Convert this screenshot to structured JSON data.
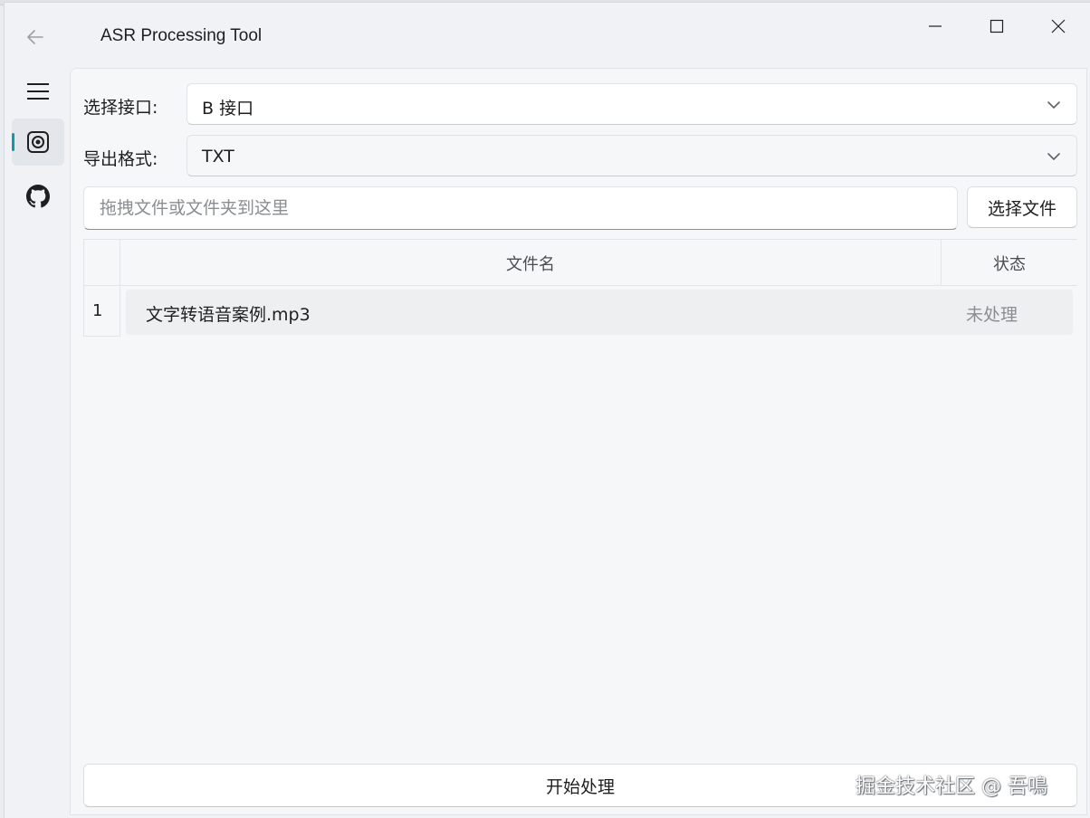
{
  "window": {
    "title": "ASR Processing Tool"
  },
  "sidebar": {
    "items": [
      {
        "name": "menu",
        "icon": "hamburger-menu-icon"
      },
      {
        "name": "asr",
        "icon": "record-icon",
        "active": true
      },
      {
        "name": "github",
        "icon": "github-icon"
      }
    ],
    "accent": "#0f9aa8"
  },
  "form": {
    "interface_label": "选择接口:",
    "interface_value": "B 接口",
    "format_label": "导出格式:",
    "format_value": "TXT"
  },
  "dropzone": {
    "placeholder": "拖拽文件或文件夹到这里",
    "choose_button": "选择文件"
  },
  "table": {
    "headers": [
      "文件名",
      "状态"
    ],
    "rows": [
      {
        "index": "1",
        "name": "文字转语音案例.mp3",
        "status": "未处理"
      }
    ]
  },
  "actions": {
    "start_button": "开始处理"
  },
  "watermark": "掘金技术社区 @ 吾鳴"
}
